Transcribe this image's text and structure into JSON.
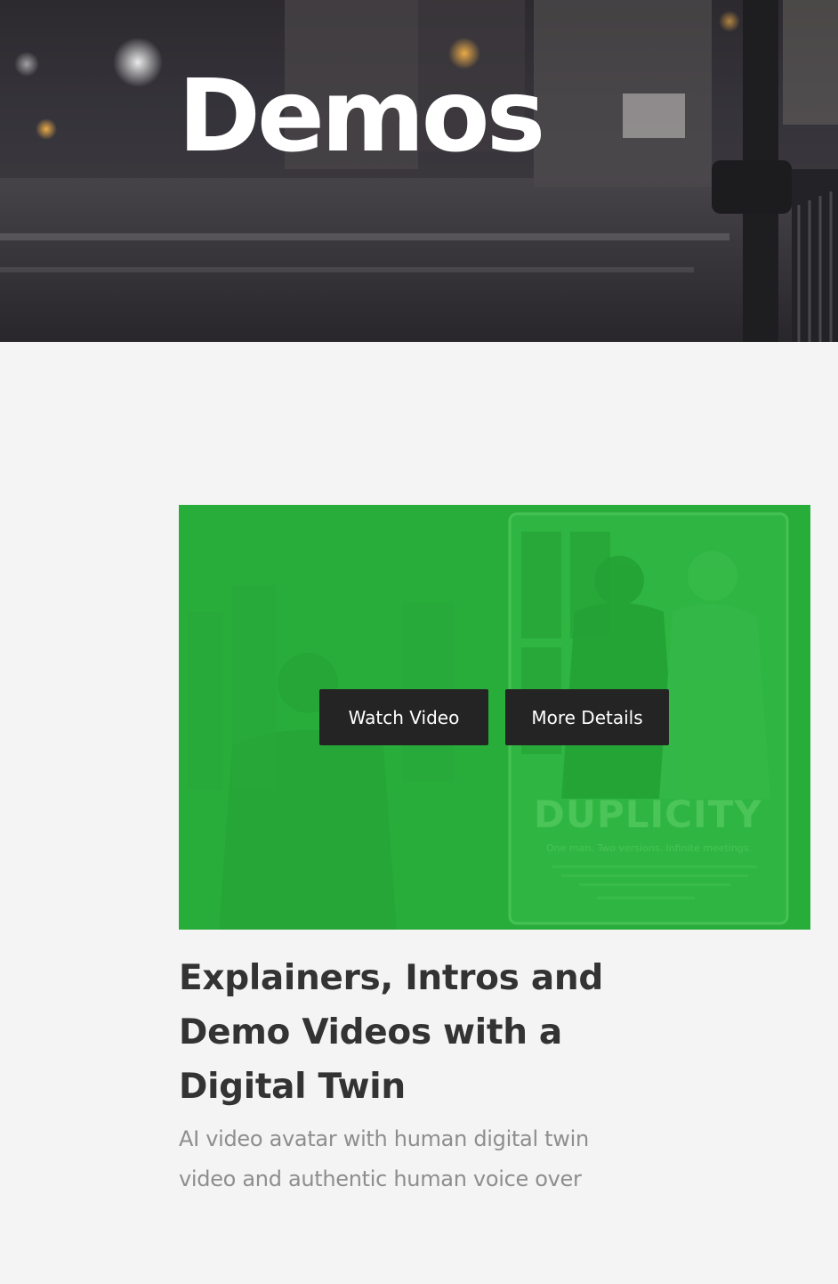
{
  "hero": {
    "title": "Demos"
  },
  "card": {
    "poster": {
      "title": "DUPLICITY",
      "tagline": "One man. Two versions. Infinite meetings."
    },
    "buttons": {
      "watch": "Watch Video",
      "details": "More Details"
    },
    "title": "Explainers, Intros and Demo Videos with a Digital Twin",
    "description": "AI video avatar with human digital twin video and authentic human voice over"
  },
  "colors": {
    "overlay_green": "#29ad3a",
    "button_bg": "#242424",
    "page_bg": "#f4f4f4",
    "title_text": "#333333",
    "desc_text": "#8e8e8e"
  }
}
